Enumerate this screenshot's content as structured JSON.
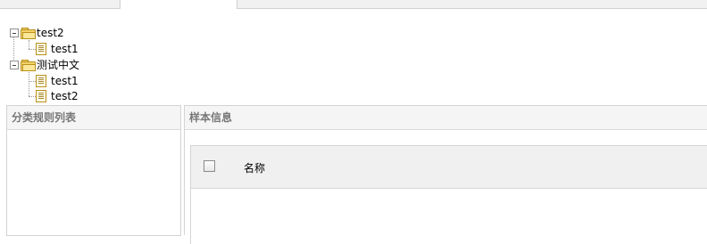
{
  "tree": {
    "nodes": [
      {
        "label": "test2",
        "icon": "folder-icon",
        "expanded": true,
        "children": [
          {
            "label": "test1",
            "icon": "file-icon"
          }
        ]
      },
      {
        "label": "测试中文",
        "icon": "folder-icon",
        "expanded": true,
        "children": [
          {
            "label": "test1",
            "icon": "file-icon"
          },
          {
            "label": "test2",
            "icon": "file-icon"
          }
        ]
      }
    ]
  },
  "left_panel": {
    "title": "分类规则列表"
  },
  "right_panel": {
    "title": "样本信息",
    "grid": {
      "columns": [
        "名称"
      ],
      "select_all_checked": false
    }
  },
  "colors": {
    "panel_header_bg": "#f5f5f5",
    "panel_header_text": "#777777",
    "grid_header_bg": "#f0f0f0",
    "border": "#d3d3d3",
    "folder": "#f3d36a"
  }
}
